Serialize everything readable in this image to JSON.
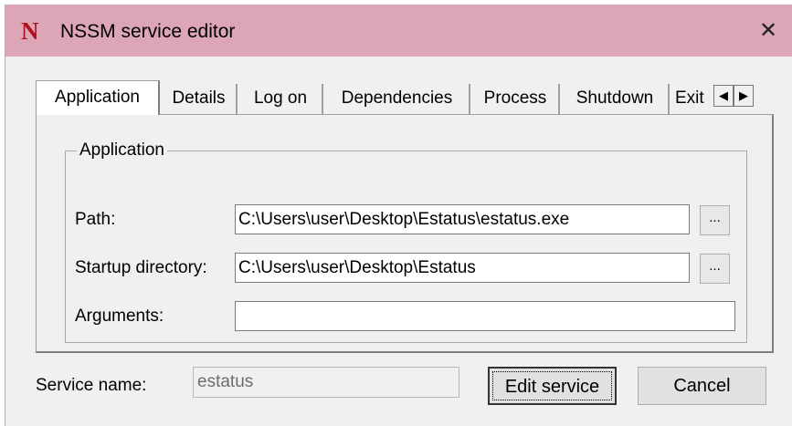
{
  "window": {
    "title": "NSSM service editor",
    "app_icon_letter": "N",
    "close_glyph": "✕"
  },
  "tabs": [
    {
      "label": "Application",
      "active": true
    },
    {
      "label": "Details",
      "active": false
    },
    {
      "label": "Log on",
      "active": false
    },
    {
      "label": "Dependencies",
      "active": false
    },
    {
      "label": "Process",
      "active": false
    },
    {
      "label": "Shutdown",
      "active": false
    },
    {
      "label": "Exit",
      "active": false
    }
  ],
  "tab_scroll": {
    "left_glyph": "◀",
    "right_glyph": "▶"
  },
  "application_group": {
    "legend": "Application",
    "path_label": "Path:",
    "path_value": "C:\\Users\\user\\Desktop\\Estatus\\estatus.exe",
    "startup_label": "Startup directory:",
    "startup_value": "C:\\Users\\user\\Desktop\\Estatus",
    "arguments_label": "Arguments:",
    "arguments_value": "",
    "browse_label": "..."
  },
  "footer": {
    "service_name_label": "Service name:",
    "service_name_value": "estatus",
    "edit_button": "Edit service",
    "cancel_button": "Cancel"
  },
  "colors": {
    "titlebar": "#dda6b6",
    "icon_red": "#b01020",
    "dialog_bg": "#f0f0f0"
  }
}
